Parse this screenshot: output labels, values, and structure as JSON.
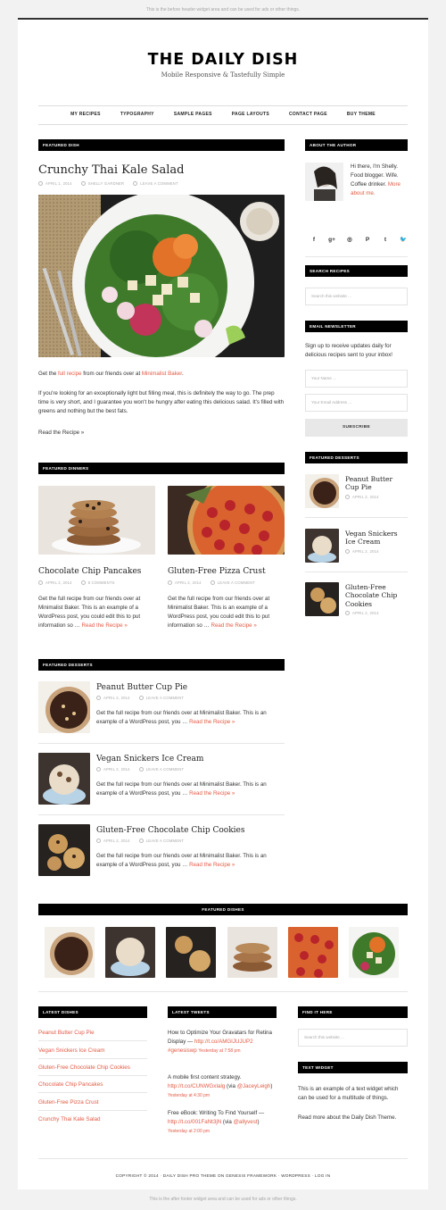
{
  "before_header": "This is the before header widget area and can be used for ads or other things.",
  "after_footer": "This is the after footer widget area and can be used for ads or other things.",
  "site": {
    "title": "THE DAILY DISH",
    "description": "Mobile Responsive & Tastefully Simple"
  },
  "nav": [
    "MY RECIPES",
    "TYPOGRAPHY",
    "SAMPLE PAGES",
    "PAGE LAYOUTS",
    "CONTACT PAGE",
    "BUY THEME"
  ],
  "featured_dish": {
    "heading": "FEATURED DISH",
    "title": "Crunchy Thai Kale Salad",
    "date": "APRIL 1, 2014",
    "author": "SHELLY GARDNER",
    "comments": "LEAVE A COMMENT",
    "intro_prefix": "Get the ",
    "intro_link1": "full recipe",
    "intro_mid": " from our friends over at ",
    "intro_link2": "Minimalist Baker",
    "intro_suffix": ".",
    "body": "If you're looking for an exceptionally light but filling meal, this is definitely the way to go. The prep time is very short, and I guarantee you won't be hungry after eating this delicious salad. It's filled with greens and nothing but the best fats.",
    "read_more": "Read the Recipe »"
  },
  "featured_dinners": {
    "heading": "FEATURED DINNERS",
    "items": [
      {
        "title": "Chocolate Chip Pancakes",
        "date": "APRIL 2, 2014",
        "comments": "8 COMMENTS",
        "excerpt": "Get the full recipe from our friends over at Minimalist Baker. This is an example of a WordPress post, you could edit this to put information so …",
        "read_more": "Read the Recipe »"
      },
      {
        "title": "Gluten-Free Pizza Crust",
        "date": "APRIL 2, 2014",
        "comments": "LEAVE A COMMENT",
        "excerpt": "Get the full recipe from our friends over at Minimalist Baker. This is an example of a WordPress post, you could edit this to put information so …",
        "read_more": "Read the Recipe »"
      }
    ]
  },
  "featured_desserts_main": {
    "heading": "FEATURED DESSERTS",
    "items": [
      {
        "title": "Peanut Butter Cup Pie",
        "date": "APRIL 2, 2014",
        "comments": "LEAVE A COMMENT",
        "excerpt": "Get the full recipe from our friends over at Minimalist Baker. This is an example of a WordPress post, you …",
        "read_more": "Read the Recipe »"
      },
      {
        "title": "Vegan Snickers Ice Cream",
        "date": "APRIL 2, 2014",
        "comments": "LEAVE A COMMENT",
        "excerpt": "Get the full recipe from our friends over at Minimalist Baker. This is an example of a WordPress post, you …",
        "read_more": "Read the Recipe »"
      },
      {
        "title": "Gluten-Free Chocolate Chip Cookies",
        "date": "APRIL 2, 2014",
        "comments": "LEAVE A COMMENT",
        "excerpt": "Get the full recipe from our friends over at Minimalist Baker. This is an example of a WordPress post, you …",
        "read_more": "Read the Recipe »"
      }
    ]
  },
  "sidebar": {
    "about": {
      "heading": "ABOUT THE AUTHOR",
      "text": "Hi there, I'm Shelly. Food blogger. Wife. Coffee drinker.",
      "link": "More about me."
    },
    "social_icons": [
      "f",
      "g+",
      "◎",
      "P",
      "t",
      "🐦"
    ],
    "search": {
      "heading": "SEARCH RECIPES",
      "placeholder": "Search this website ..."
    },
    "newsletter": {
      "heading": "EMAIL NEWSLETTER",
      "text": "Sign up to receive updates daily for delicious recipes sent to your inbox!",
      "name_placeholder": "Your Name ...",
      "email_placeholder": "Your Email Address ...",
      "button": "SUBSCRIBE"
    },
    "desserts": {
      "heading": "FEATURED DESSERTS",
      "items": [
        {
          "title": "Peanut Butter Cup Pie",
          "date": "APRIL 2, 2014"
        },
        {
          "title": "Vegan Snickers Ice Cream",
          "date": "APRIL 2, 2014"
        },
        {
          "title": "Gluten-Free Chocolate Chip Cookies",
          "date": "APRIL 2, 2014"
        }
      ]
    }
  },
  "featured_dishes": {
    "heading": "FEATURED DISHES"
  },
  "footer_widgets": {
    "latest": {
      "heading": "LATEST DISHES",
      "items": [
        "Peanut Butter Cup Pie",
        "Vegan Snickers Ice Cream",
        "Gluten-Free Chocolate Chip Cookies",
        "Chocolate Chip Pancakes",
        "Gluten-Free Pizza Crust",
        "Crunchy Thai Kale Salad"
      ]
    },
    "tweets": {
      "heading": "LATEST TWEETS",
      "items": [
        {
          "text": "How to Optimize Your Gravatars for Retina Display — ",
          "link": "http://t.co/AMGIJUJUP2 #genesiswp",
          "time": "Yesterday at 7:58 pm"
        },
        {
          "text": "A mobile first content strategy. ",
          "link": "http://t.co/CUNWGxIalg",
          "via_prefix": " (via ",
          "via": "@JaceyLeigh",
          "via_suffix": ")",
          "time": "Yesterday at 4:30 pm"
        },
        {
          "text": "Free eBook: Writing To Find Yourself — ",
          "link": "http://t.co/001FaNt3jN",
          "via_prefix": " (via ",
          "via": "@allyvest",
          "via_suffix": ")",
          "time": "Yesterday at 2:00 pm"
        }
      ]
    },
    "find": {
      "heading": "FIND IT HERE",
      "placeholder": "Search this website ..."
    },
    "text_widget": {
      "heading": "TEXT WIDGET",
      "text": "This is an example of a text widget which can be used for a multitude of things.",
      "link": "Read more about the Daily Dish Theme."
    }
  },
  "copyright": "COPYRIGHT © 2014 · DAILY DISH PRO THEME ON GENESIS FRAMEWORK · WORDPRESS · LOG IN"
}
